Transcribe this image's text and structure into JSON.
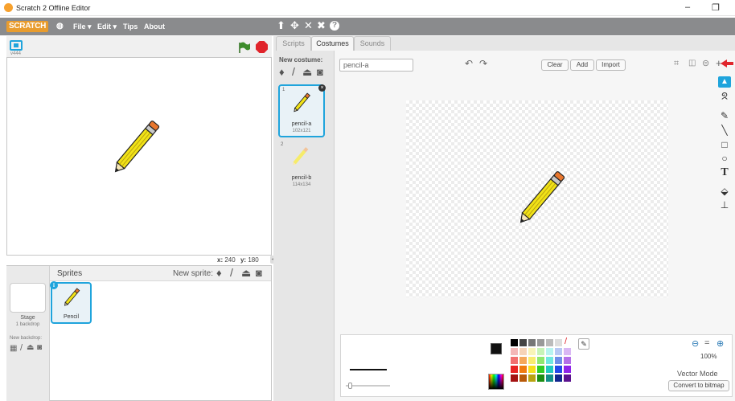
{
  "window": {
    "title": "Scratch 2 Offline Editor",
    "minimize": "–",
    "restore": "❐"
  },
  "menu": {
    "logo": "SCRATCH",
    "globe": "🌐",
    "file": "File ▾",
    "edit": "Edit ▾",
    "tips": "Tips",
    "about": "About",
    "tools": [
      "⬆",
      "✥",
      "⤧",
      "⤨",
      "?"
    ]
  },
  "stage": {
    "version": "v444",
    "x_label": "x:",
    "x_value": "240",
    "y_label": "y:",
    "y_value": "180"
  },
  "sprites": {
    "header": "Sprites",
    "new_sprite_label": "New sprite:",
    "items": [
      {
        "name": "Pencil"
      }
    ]
  },
  "stage_col": {
    "label": "Stage",
    "sub": "1 backdrop",
    "new_backdrop": "New backdrop:"
  },
  "tabs": [
    {
      "label": "Scripts"
    },
    {
      "label": "Costumes"
    },
    {
      "label": "Sounds"
    }
  ],
  "costumes": {
    "new_label": "New costume:",
    "items": [
      {
        "index": "1",
        "name": "pencil-a",
        "size": "102x121"
      },
      {
        "index": "2",
        "name": "pencil-b",
        "size": "114x134"
      }
    ]
  },
  "editor": {
    "costume_name": "pencil-a",
    "clear": "Clear",
    "add": "Add",
    "import": "Import",
    "zoom": "100%",
    "mode": "Vector Mode",
    "convert": "Convert to bitmap"
  },
  "colors": {
    "accent": "#1fa4dc",
    "menubar": "#8a8b8d",
    "flag": "#3d8c2c",
    "stop": "#e0232a",
    "pencil": "#f1e217",
    "pencil_tip": "#e8762d",
    "arrow": "#e0262d"
  },
  "palette": [
    "#000000",
    "#444444",
    "#777777",
    "#999999",
    "#bbbbbb",
    "#dddddd",
    "#ffffff",
    "#f4b7b7",
    "#f6d3b7",
    "#f8f4b7",
    "#c7f4b7",
    "#b7f4f0",
    "#b7c8f4",
    "#d9b7f4",
    "#f26f6f",
    "#f5a85b",
    "#f8ec6f",
    "#8fe86f",
    "#6fe8e0",
    "#6f8ee8",
    "#b46fe8",
    "#e82323",
    "#f07b0f",
    "#f6de1a",
    "#30cc23",
    "#1fc9c0",
    "#2348e8",
    "#8f23e8",
    "#a41212",
    "#b85a09",
    "#b9a311",
    "#1c8f13",
    "#128f88",
    "#12278f",
    "#5c128f"
  ]
}
